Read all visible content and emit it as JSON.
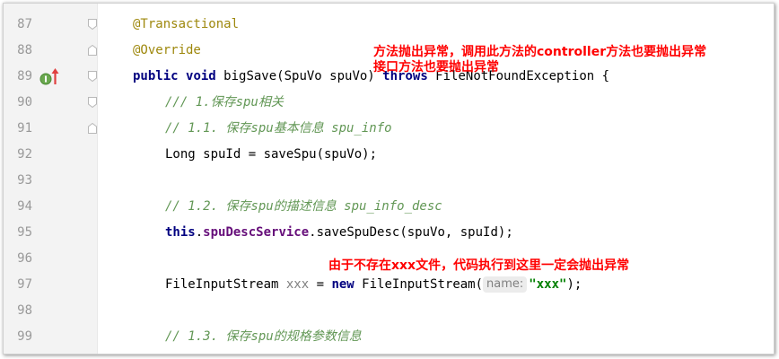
{
  "editor": {
    "lines": [
      {
        "num": "87",
        "code": "@Transactional"
      },
      {
        "num": "88",
        "code": "@Override"
      },
      {
        "num": "89",
        "kw1": "public",
        "kw2": "void",
        "sig": " bigSave(SpuVo spuVo) ",
        "kw3": "throws",
        "rest": " FileNotFoundException {"
      },
      {
        "num": "90",
        "code": "/// 1.保存spu相关"
      },
      {
        "num": "91",
        "code": "// 1.1. 保存spu基本信息 spu_info"
      },
      {
        "num": "92",
        "code": "Long spuId = saveSpu(spuVo);"
      },
      {
        "num": "93",
        "code": ""
      },
      {
        "num": "94",
        "code": "// 1.2. 保存spu的描述信息 spu_info_desc"
      },
      {
        "num": "95",
        "kw": "this",
        "dot": ".",
        "field": "spuDescService",
        "rest": ".saveSpuDesc(spuVo, spuId);"
      },
      {
        "num": "96",
        "code": ""
      },
      {
        "num": "97",
        "type": "FileInputStream ",
        "var": "xxx",
        "eq": " = ",
        "kw": "new",
        "ctor": " FileInputStream(",
        "hint": "name:",
        "str": "\"xxx\"",
        "end": ");"
      },
      {
        "num": "98",
        "code": ""
      },
      {
        "num": "99",
        "code": "// 1.3. 保存spu的规格参数信息"
      }
    ]
  },
  "annotations": {
    "note1_line1": "方法抛出异常，调用此方法的controller方法也要抛出异常",
    "note1_line2": "接口方法也要抛出异常",
    "note2": "由于不存在xxx文件，代码执行到这里一定会抛出异常"
  },
  "colors": {
    "annotation": "#9e880d",
    "keyword": "#000080",
    "comment": "#629755",
    "field": "#660e7a",
    "string": "#008000",
    "note": "#ff0000"
  },
  "icons": {
    "implements": "implements-method-icon",
    "arrow": "red-up-arrow-icon",
    "fold": "fold-marker-icon"
  }
}
